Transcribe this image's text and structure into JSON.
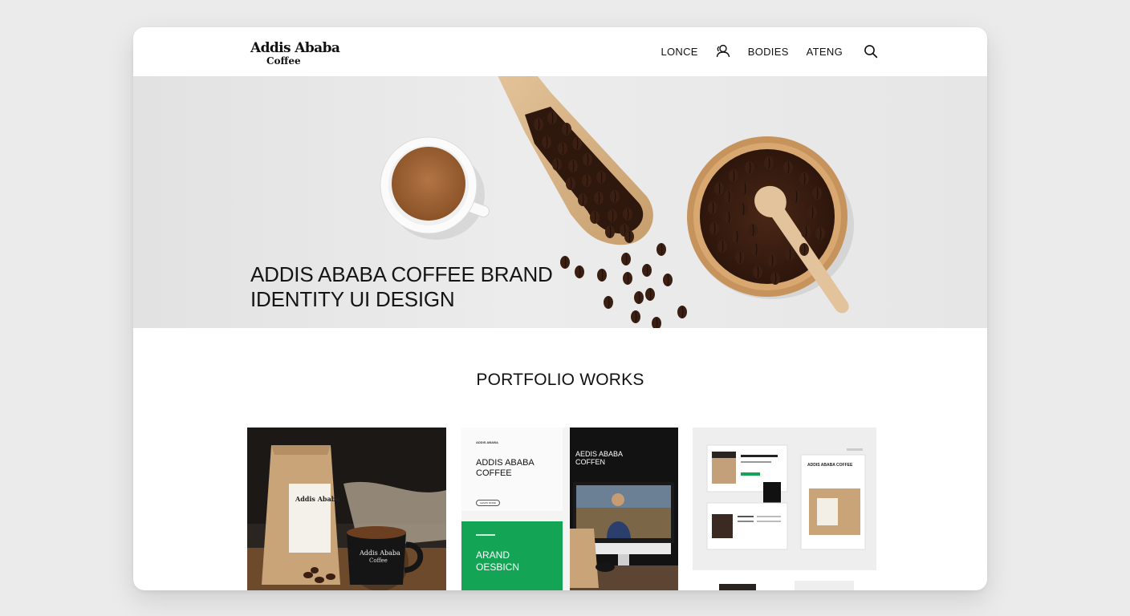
{
  "brand": {
    "line1": "Addis Ababa",
    "line2": "Coffee"
  },
  "nav": {
    "items": [
      "LONCE",
      "BODIES",
      "ATENG"
    ],
    "user_icon": "user-group-icon",
    "search_icon": "search-icon"
  },
  "hero": {
    "title_line1": "ADDIS ABABA COFFEE BRAND",
    "title_line2": "IDENTITY UI DESIGN"
  },
  "portfolio": {
    "title": "PORTFOLIO WORKS",
    "card1": {
      "bag_label": "Addis Ababa",
      "mug_label_1": "Addis Ababa",
      "mug_label_2": "Coffee"
    },
    "card2": {
      "eyebrow": "ADDIS ABABA",
      "heading_1": "ADDIS ABABA",
      "heading_2": "COFFEE",
      "button": "LEARN MORE",
      "dark_heading_1": "AEDIS ABABA",
      "dark_heading_2": "COFFEN",
      "green_1": "ARAND",
      "green_2": "OESBICN"
    },
    "card3": {
      "doc_title_1": "ADDIS ABABA",
      "doc_title_2": "ADDIS ABABA COFFEE"
    }
  },
  "colors": {
    "accent_green": "#13a455",
    "dark": "#151515",
    "kraft": "#c9a57a",
    "wood": "#d7b489"
  }
}
